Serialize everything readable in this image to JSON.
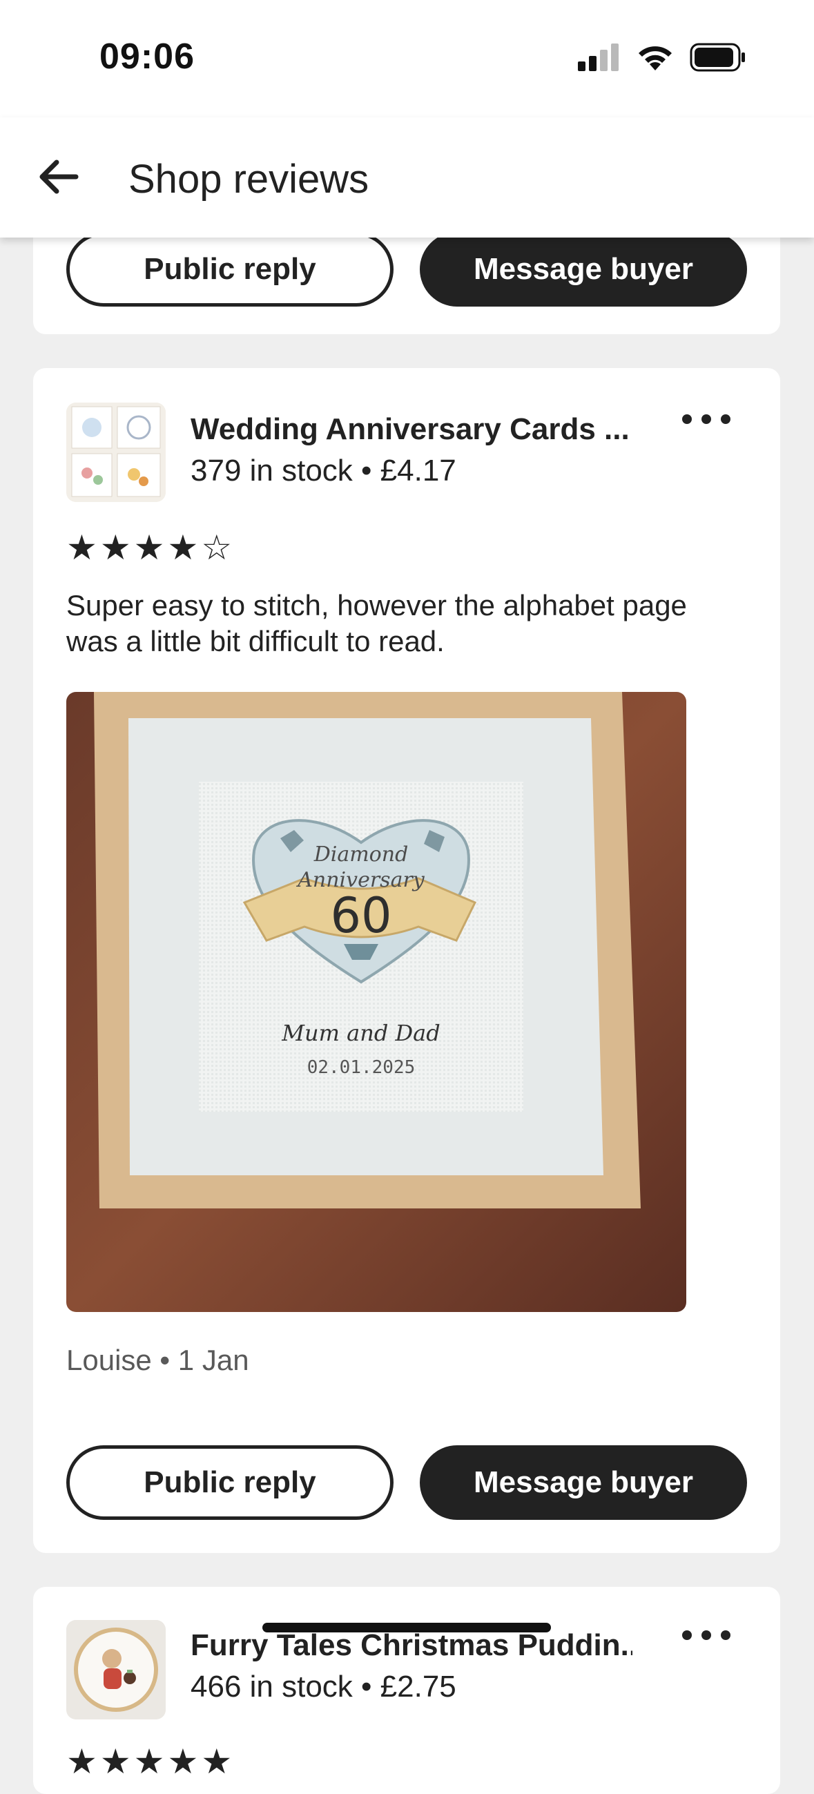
{
  "status_bar": {
    "time": "09:06"
  },
  "header": {
    "title": "Shop reviews"
  },
  "review_prev": {
    "public_reply_label": "Public reply",
    "message_buyer_label": "Message buyer"
  },
  "review_main": {
    "listing_title": "Wedding Anniversary Cards ...",
    "listing_meta": "379 in stock • £4.17",
    "rating": 4,
    "rating_max": 5,
    "text": "Super easy to stitch, however the alphabet page was a little bit difficult to read.",
    "photo_text": {
      "line1": "Diamond",
      "line2": "Anniversary",
      "number": "60",
      "names": "Mum and Dad",
      "date": "02.01.2025"
    },
    "reviewer_line": "Louise • 1 Jan",
    "public_reply_label": "Public reply",
    "message_buyer_label": "Message buyer"
  },
  "review_next": {
    "listing_title": "Furry Tales Christmas Puddin...",
    "listing_meta": "466 in stock • £2.75",
    "rating": 5,
    "rating_max": 5
  },
  "colors": {
    "background": "#efefef",
    "card": "#ffffff",
    "text": "#222222",
    "muted": "#595959",
    "filled_button": "#222222"
  },
  "icons": {
    "back": "arrow-left-icon",
    "more": "more-horizontal-icon",
    "star": "star-icon",
    "signal": "cellular-signal-icon",
    "wifi": "wifi-icon",
    "battery": "battery-icon"
  }
}
